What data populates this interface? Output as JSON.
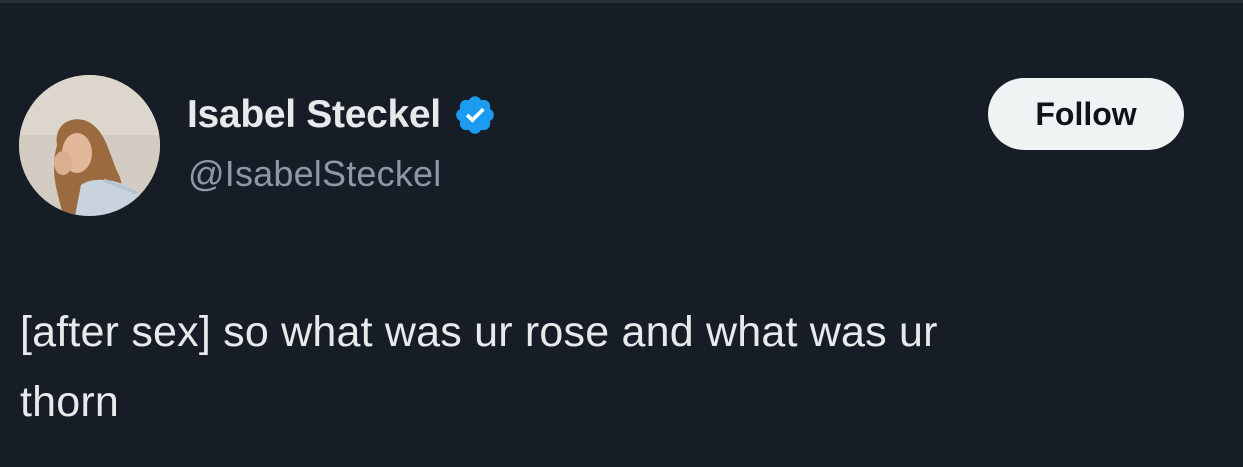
{
  "author": {
    "display_name": "Isabel Steckel",
    "handle": "@IsabelSteckel",
    "verified": true,
    "avatar_icon": "profile-photo"
  },
  "actions": {
    "follow_label": "Follow"
  },
  "tweet": {
    "text_line_1": "[after sex] so what was ur rose and what was ur",
    "text_line_2": "thorn"
  },
  "colors": {
    "background": "#161d27",
    "primary_text": "#e7e9ea",
    "secondary_text": "#8b98a5",
    "verified_blue": "#1d9bf0",
    "follow_button_bg": "#eff3f4"
  }
}
